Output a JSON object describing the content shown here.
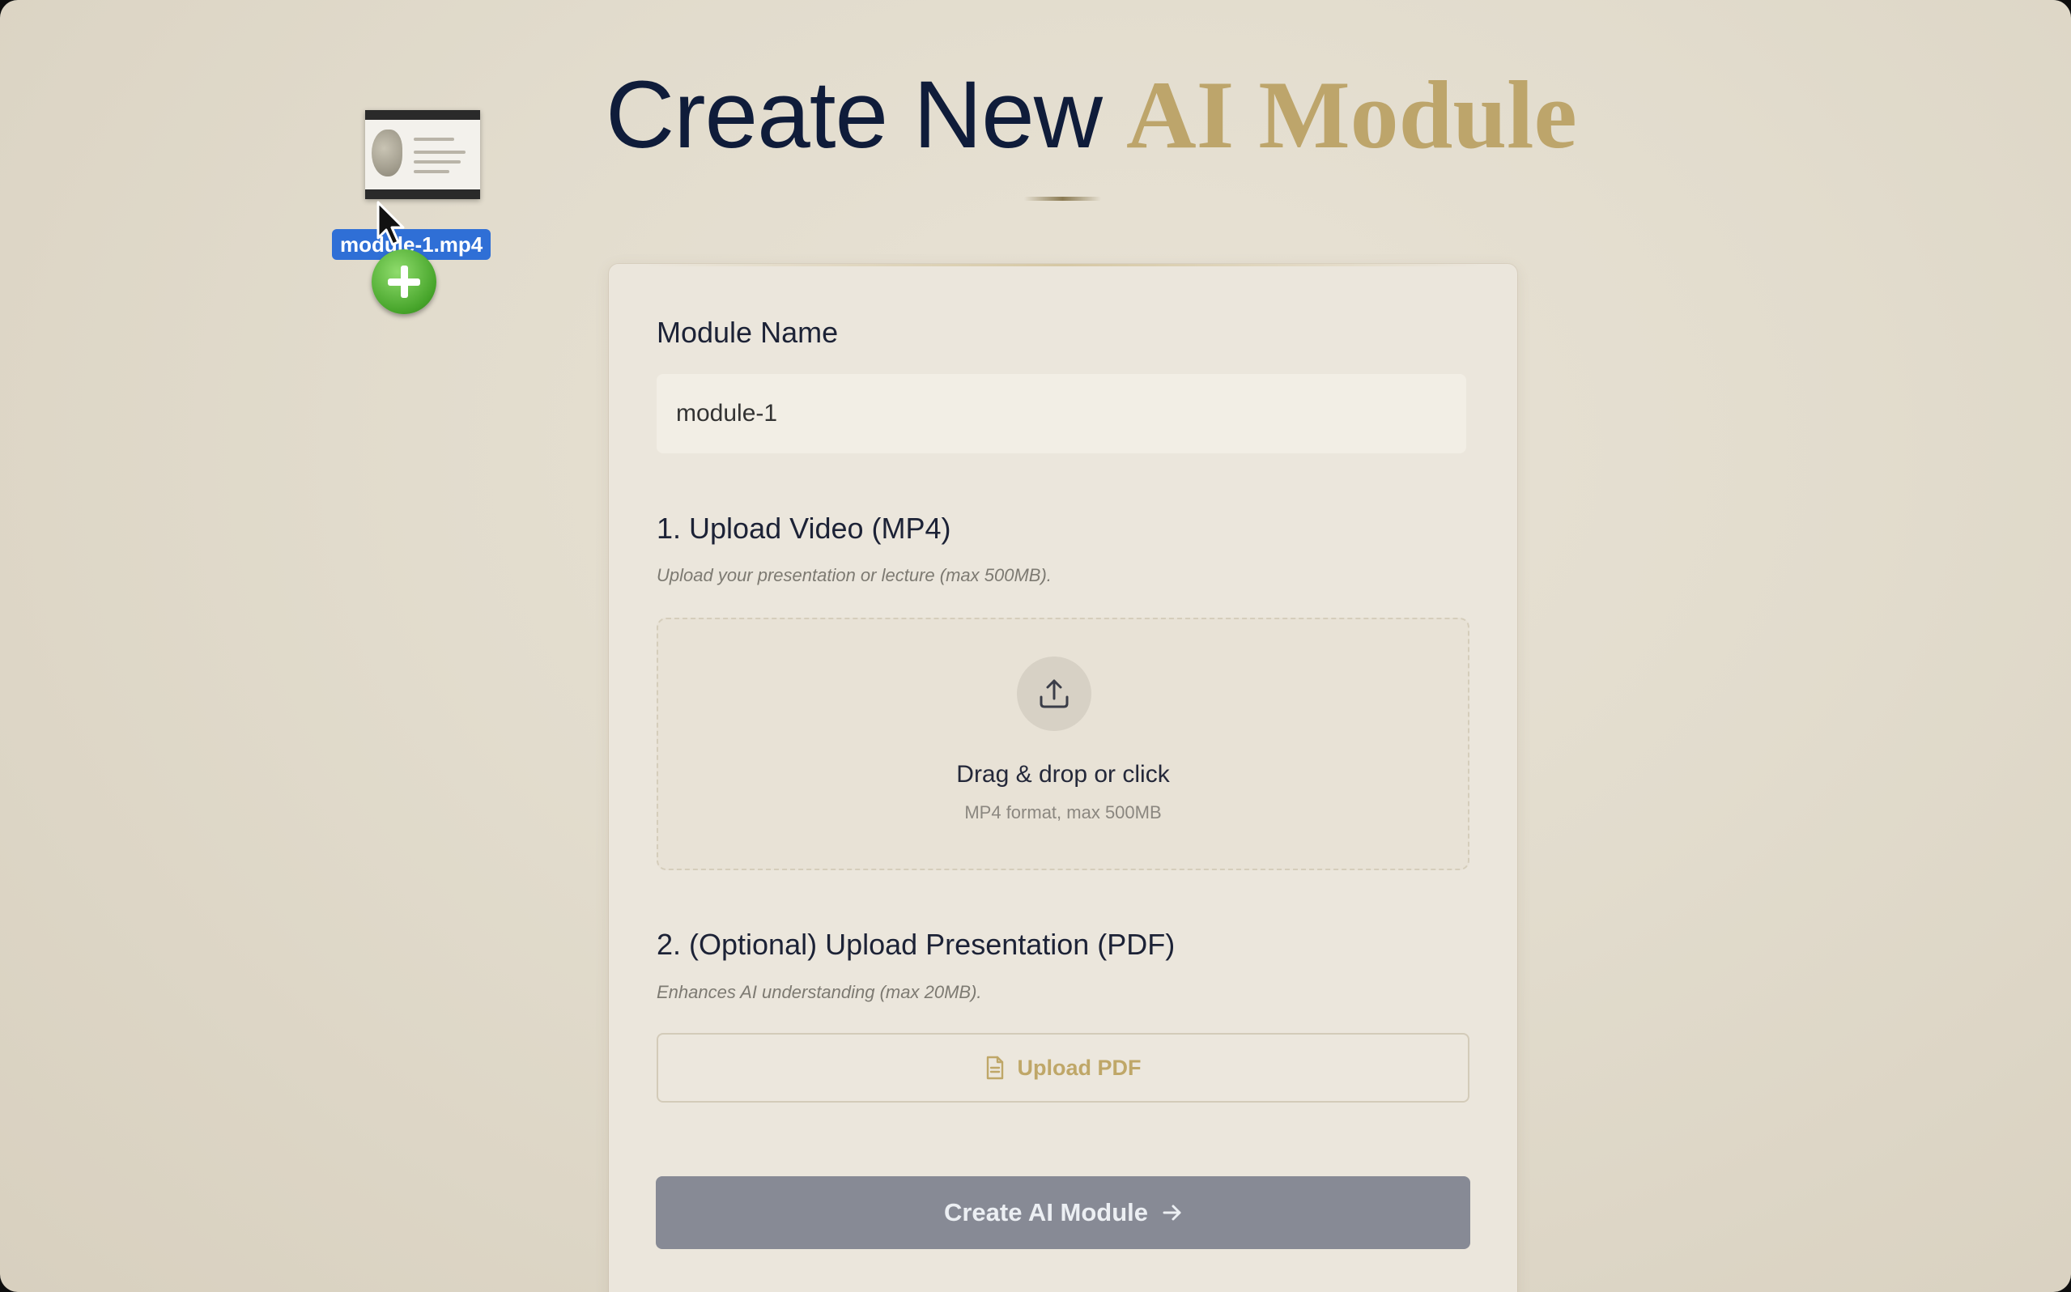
{
  "page": {
    "title_main": "Create New",
    "title_accent": "AI Module"
  },
  "module_name": {
    "label": "Module Name",
    "value": "module-1"
  },
  "video_upload": {
    "heading": "1. Upload Video (MP4)",
    "hint": "Upload your presentation or lecture (max 500MB).",
    "drop_title": "Drag & drop or click",
    "drop_subtitle": "MP4 format, max 500MB",
    "icon": "upload-icon"
  },
  "pdf_upload": {
    "heading": "2. (Optional) Upload Presentation (PDF)",
    "hint": "Enhances AI understanding (max 20MB).",
    "button_label": "Upload PDF",
    "icon": "document-icon"
  },
  "create_button": {
    "label": "Create AI Module",
    "icon": "arrow-right-icon"
  },
  "drag_overlay": {
    "file_name": "module-1.mp4",
    "badge_icon": "plus-icon"
  },
  "colors": {
    "title_main": "#0f1c3a",
    "title_accent": "#bda56b",
    "create_button_bg": "#878a95",
    "pdf_button_text": "#bfa768",
    "drag_label_bg": "#2f6fd6",
    "copy_badge": "#46a42a"
  }
}
